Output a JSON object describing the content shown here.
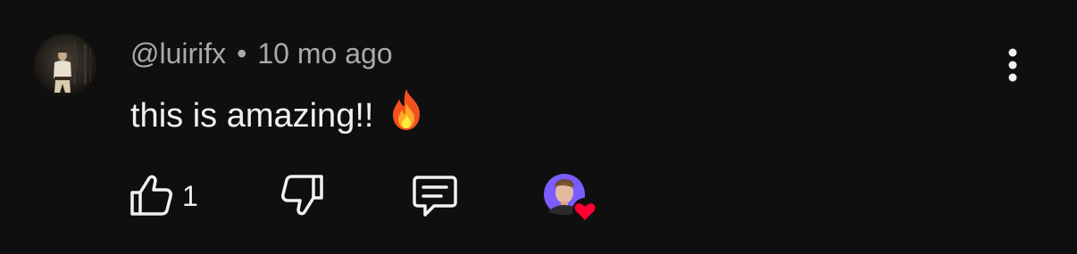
{
  "comment": {
    "author": "@luirifx",
    "separator": "•",
    "timestamp": "10 mo ago",
    "text": "this is amazing!!",
    "emoji": "fire"
  },
  "actions": {
    "like_count": "1",
    "like_icon": "thumbs-up-icon",
    "dislike_icon": "thumbs-down-icon",
    "reply_icon": "reply-comment-icon",
    "creator_heart_icon": "creator-heart-icon",
    "more_icon": "more-vert-icon"
  },
  "colors": {
    "background": "#0f0f0f",
    "meta_text": "#aaaaaa",
    "body_text": "#f1f1f1",
    "heart": "#ff0033",
    "creator_avatar_bg": "#7b5cff"
  }
}
